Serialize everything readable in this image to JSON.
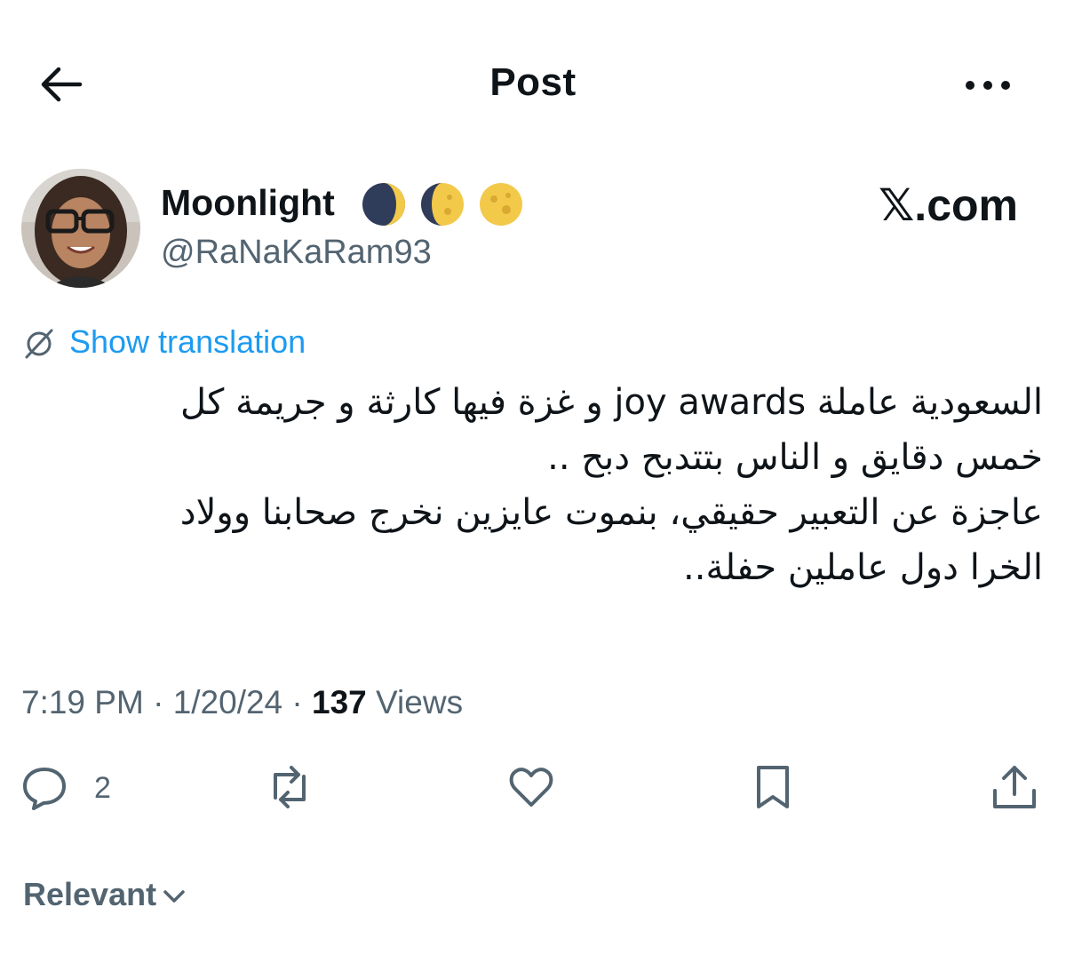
{
  "header": {
    "title": "Post"
  },
  "author": {
    "name": "Moonlight",
    "handle": "@RaNaKaRam93",
    "emojis": [
      "waning-crescent-moon",
      "waxing-gibbous-moon",
      "full-moon"
    ]
  },
  "watermark": "𝕏.com",
  "translation": {
    "label": "Show translation"
  },
  "tweet": {
    "lines": [
      "السعودية عاملة joy awards و غزة فيها كارثة و جريمة كل",
      "خمس دقايق و الناس بتتدبح دبح ..",
      "عاجزة عن التعبير حقيقي، بنموت عايزين نخرج صحابنا وولاد",
      "الخرا دول عاملين حفلة.."
    ]
  },
  "meta": {
    "time": "7:19 PM",
    "sep1": " · ",
    "date": "1/20/24",
    "sep2": " · ",
    "views_count": "137",
    "views_label": " Views"
  },
  "actions": {
    "reply_count": "2"
  },
  "sort": {
    "label": "Relevant"
  },
  "colors": {
    "accent": "#1d9bf0",
    "text_primary": "#0f1419",
    "text_secondary": "#536471"
  }
}
